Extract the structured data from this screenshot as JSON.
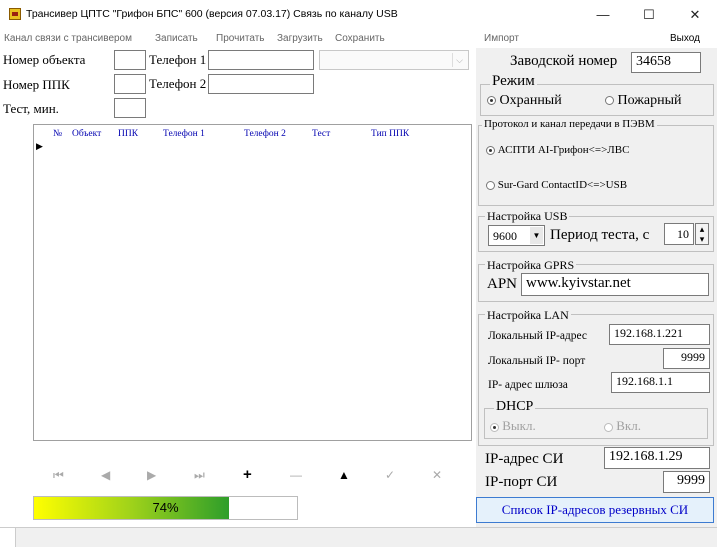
{
  "window": {
    "title": "Трансивер ЦПТС \"Грифон БПС\" 600 (версия 07.03.17)   Связь по каналу USB",
    "minimize": "—",
    "maximize": "☐",
    "close": "✕"
  },
  "menu": {
    "items": [
      "Канал связи с трансивером",
      "Записать",
      "Прочитать",
      "Загрузить",
      "Сохранить"
    ],
    "import": "Импорт",
    "exit": "Выход"
  },
  "fields": {
    "object_label": "Номер объекта",
    "ppk_label": "Номер ППК",
    "test_label": "Тест, мин.",
    "phone1_label": "Телефон 1",
    "phone2_label": "Телефон 2"
  },
  "grid": {
    "columns": [
      "№",
      "Объект",
      "ППК",
      "Телефон 1",
      "Телефон 2",
      "Тест",
      "Тип ППК"
    ],
    "row_marker": "▶"
  },
  "navigator": [
    "⏮",
    "◀",
    "▶",
    "⏭",
    "+",
    "—",
    "▲",
    "✓",
    "✕"
  ],
  "progress": {
    "value": 0.74,
    "label": "74%"
  },
  "right": {
    "serial_label": "Заводской номер",
    "serial_value": "34658",
    "mode_title": "Режим",
    "mode_options": [
      "Охранный",
      "Пожарный"
    ],
    "mode_selected": "Охранный",
    "protocol_title": "Протокол и канал передачи в ПЭВМ",
    "protocol_options": [
      "АСПТИ АI-Грифон<=>ЛВС",
      "Sur-Gard ContactID<=>USB"
    ],
    "protocol_selected": "АСПТИ АI-Грифон<=>ЛВС",
    "usb_title": "Настройка USB",
    "usb_speed": "9600",
    "test_period_label": "Период теста, с",
    "test_period_value": "10",
    "gprs_title": "Настройка GPRS",
    "apn_label": "APN",
    "apn_value": "www.kyivstar.net",
    "lan_title": "Настройка LAN",
    "local_ip_label": "Локальный IP-адрес",
    "local_ip_value": "192.168.1.221",
    "local_port_label": "Локальный IP- порт",
    "local_port_value": "9999",
    "gateway_label": "IP- адрес шлюза",
    "gateway_value": "192.168.1.1",
    "dhcp_title": "DHCP",
    "dhcp_options": [
      "Выкл.",
      "Вкл."
    ],
    "dhcp_selected": "Выкл.",
    "si_ip_label": "IP-адрес СИ",
    "si_ip_value": "192.168.1.29",
    "si_port_label": "IP-порт СИ",
    "si_port_value": "9999",
    "backup_button": "Список IP-адресов резервных СИ"
  },
  "colors": {
    "progress_start": "#ffff00",
    "progress_end": "#2e9e2a",
    "link_blue": "#0000c8"
  }
}
